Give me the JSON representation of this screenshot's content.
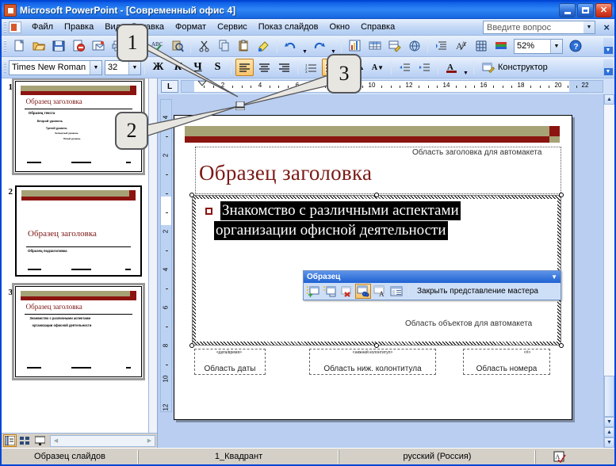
{
  "window": {
    "title": "Microsoft PowerPoint - [Современный офис 4]",
    "app_icon": "powerpoint-icon",
    "minimize_label": "Свернуть",
    "maximize_label": "Развернуть",
    "close_label": "Закрыть"
  },
  "menubar": {
    "items": [
      {
        "label": "Файл",
        "mnemonic": "Ф"
      },
      {
        "label": "Правка",
        "mnemonic": "П"
      },
      {
        "label": "Вид",
        "mnemonic": "В"
      },
      {
        "label": "Вставка",
        "mnemonic": "с"
      },
      {
        "label": "Формат",
        "mnemonic": "м"
      },
      {
        "label": "Сервис",
        "mnemonic": "е"
      },
      {
        "label": "Показ слайдов",
        "mnemonic": "ы"
      },
      {
        "label": "Окно",
        "mnemonic": "О"
      },
      {
        "label": "Справка",
        "mnemonic": "С"
      }
    ],
    "ask_box": {
      "placeholder": "Введите вопрос",
      "value": ""
    },
    "close_doc_label": "×"
  },
  "standard_toolbar": {
    "buttons": [
      {
        "name": "new-icon",
        "label": "Создать"
      },
      {
        "name": "open-icon",
        "label": "Открыть"
      },
      {
        "name": "save-icon",
        "label": "Сохранить"
      },
      {
        "name": "permission-icon",
        "label": "Разрешения"
      },
      {
        "name": "email-icon",
        "label": "Сообщение"
      },
      {
        "name": "print-icon",
        "label": "Печать"
      },
      {
        "name": "preview-icon",
        "label": "Предварительный просмотр"
      },
      {
        "name": "spelling-icon",
        "label": "Орфография"
      },
      {
        "name": "research-icon",
        "label": "Справочные материалы"
      },
      {
        "name": "cut-icon",
        "label": "Вырезать"
      },
      {
        "name": "copy-icon",
        "label": "Копировать"
      },
      {
        "name": "paste-icon",
        "label": "Вставить"
      },
      {
        "name": "format-painter-icon",
        "label": "Формат по образцу"
      },
      {
        "name": "undo-icon",
        "label": "Отменить"
      },
      {
        "name": "redo-icon",
        "label": "Вернуть"
      },
      {
        "name": "insert-chart-icon",
        "label": "Добавить диаграмму"
      },
      {
        "name": "insert-table-icon",
        "label": "Добавить таблицу"
      },
      {
        "name": "tables-borders-icon",
        "label": "Таблицы и границы"
      },
      {
        "name": "insert-hyperlink-icon",
        "label": "Добавить гиперссылку"
      },
      {
        "name": "expand-all-icon",
        "label": "Развернуть все"
      },
      {
        "name": "show-formatting-icon",
        "label": "Показать форматирование"
      },
      {
        "name": "show-grid-icon",
        "label": "Сетка"
      },
      {
        "name": "color-scheme-icon",
        "label": "Цветовая схема"
      }
    ],
    "zoom": {
      "value": "52%",
      "name": "zoom-combo"
    },
    "help_icon": "help-icon",
    "overflow_label": "Параметры панелей инструментов"
  },
  "formatting_toolbar": {
    "font": {
      "value": "Times New Roman"
    },
    "size": {
      "value": "32"
    },
    "bold": "Ж",
    "italic": "К",
    "underline": "Ч",
    "shadow": "S",
    "align_left": "По левому краю",
    "align_center": "По центру",
    "align_right": "По правому краю",
    "numbering": "Нумерованный список",
    "bullets": "Маркированный список",
    "increase_font": "Увеличить размер",
    "decrease_font": "Уменьшить размер",
    "decrease_indent": "Уменьшить отступ",
    "increase_indent": "Увеличить отступ",
    "font_color": "Цвет шрифта",
    "design_button": "Конструктор",
    "design_mnemonic": "н",
    "overflow_label": "Параметры панелей инструментов"
  },
  "slides_pane": {
    "thumbnails": [
      {
        "number": "1",
        "selected": true,
        "title": "Образец заголовка",
        "lines": [
          "Образец текста",
          "Второй уровень",
          "Третий уровень",
          "Четвертый уровень",
          "Пятый уровень"
        ]
      },
      {
        "number": "2",
        "selected": false,
        "title": "Образец заголовка",
        "lines": [
          "Образец подзаголовка"
        ]
      },
      {
        "number": "3",
        "selected": false,
        "title": "Образец заголовка",
        "lines": [
          "Знакомство с различными аспектами",
          "организации офисной деятельности"
        ]
      }
    ],
    "view_buttons": [
      {
        "name": "normal-view-button",
        "label": "Обычный режим",
        "active": true
      },
      {
        "name": "slide-sorter-button",
        "label": "Сортировщик слайдов",
        "active": false
      },
      {
        "name": "slide-show-button",
        "label": "Показ слайдов",
        "active": false
      }
    ]
  },
  "rulers": {
    "horizontal_ticks": [
      "2",
      "4",
      "6",
      "8",
      "10",
      "12",
      "14",
      "16",
      "18",
      "20",
      "22"
    ],
    "vertical_ticks": [
      "4",
      "2",
      "2",
      "4",
      "6",
      "8",
      "10",
      "12"
    ],
    "corner_icon": "tab-stop-icon",
    "first_line_indent_marker": "first-line-indent-marker",
    "hanging_indent_marker": "hanging-indent-marker"
  },
  "slide": {
    "title_placeholder_hint": "Область заголовка для автомакета",
    "title_text": "Образец заголовка",
    "body_placeholder_hint": "Область объектов для автомакета",
    "body_text_line1": "Знакомство с различными аспектами",
    "body_text_line2": "организации офисной деятельности",
    "footers": [
      {
        "name": "date-area",
        "mini": "<дата/время>",
        "label": "Область даты"
      },
      {
        "name": "footer-area",
        "mini": "<нижний колонтитул>",
        "label": "Область ниж. колонтитула"
      },
      {
        "name": "number-area",
        "mini": "<#>",
        "label": "Область номера"
      }
    ],
    "band_color": "#a6a276",
    "accent_color": "#8b1410",
    "title_color": "#7b1a16"
  },
  "master_toolbar": {
    "title": "Образец",
    "menu_icon": "toolbar-options-icon",
    "buttons": [
      {
        "name": "insert-new-slide-master-icon",
        "label": "Вставить образец слайдов"
      },
      {
        "name": "insert-new-title-master-icon",
        "label": "Вставить образец заголовков"
      },
      {
        "name": "delete-master-icon",
        "label": "Удалить образец"
      },
      {
        "name": "preserve-master-icon",
        "label": "Сохранить образец",
        "active": true
      },
      {
        "name": "rename-master-icon",
        "label": "Переименовать образец"
      },
      {
        "name": "master-layout-icon",
        "label": "Разметка образца"
      }
    ],
    "close_label": "Закрыть представление мастера",
    "close_mnemonic": "ы"
  },
  "status_bar": {
    "view_name": "Образец слайдов",
    "design_name": "1_Квадрант",
    "language": "русский (Россия)",
    "spellcheck_icon": "spellcheck-icon"
  },
  "callouts": [
    {
      "number": "1",
      "target": "first-line-indent-marker"
    },
    {
      "number": "2",
      "target": "hanging-indent-marker"
    },
    {
      "number": "3",
      "target": "bullets-button"
    }
  ]
}
